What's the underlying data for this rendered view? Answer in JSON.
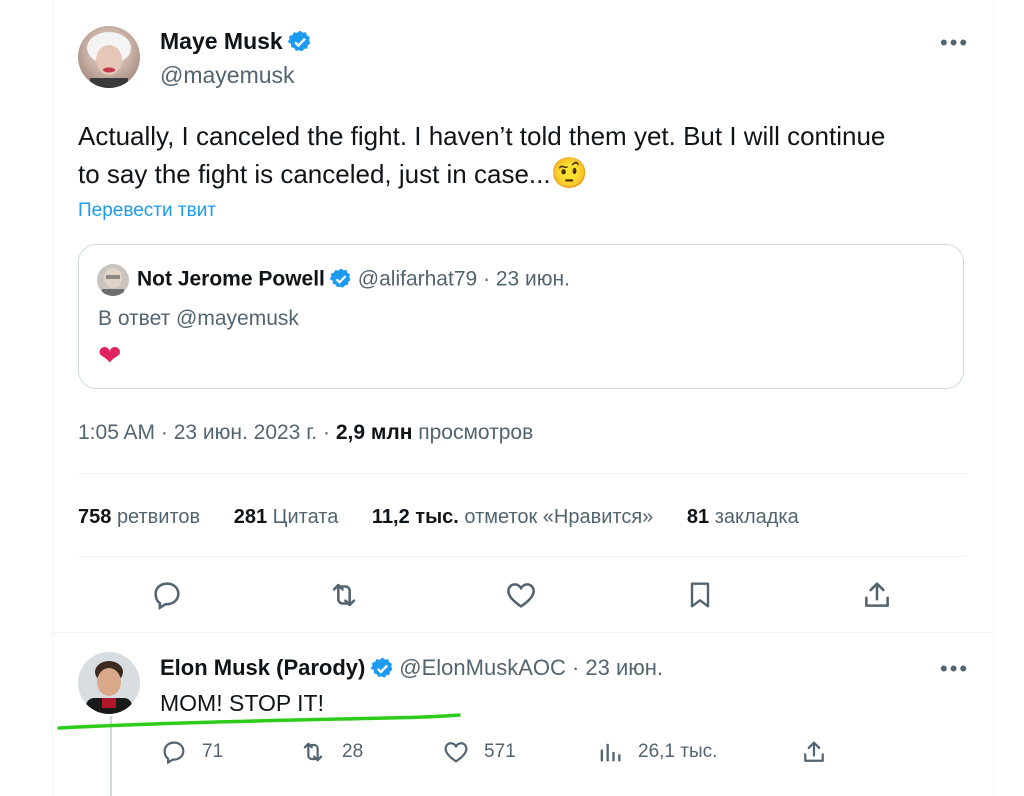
{
  "main_tweet": {
    "author_name": "Maye Musk",
    "handle": "@mayemusk",
    "text_line1": "Actually, I canceled the fight. I haven’t told them yet. But I will continue",
    "text_line2": "to say the fight is canceled, just in case...",
    "emoji": "🤨",
    "translate_label": "Перевести твит",
    "more_label": "•••",
    "quoted": {
      "author_name": "Not Jerome Powell",
      "handle_date": "@alifarhat79 · 23 июн.",
      "reply_to": "В ответ @mayemusk",
      "heart": "❤"
    },
    "meta": {
      "time_date": "1:05 AM · 23 июн. 2023 г. ·",
      "views_count": "2,9 млн",
      "views_label": "просмотров"
    },
    "stats": [
      {
        "count": "758",
        "label": "ретвитов"
      },
      {
        "count": "281",
        "label": "Цитата"
      },
      {
        "count": "11,2 тыс.",
        "label": "отметок «Нравится»"
      },
      {
        "count": "81",
        "label": "закладка"
      }
    ]
  },
  "reply_tweet": {
    "author_name": "Elon Musk (Parody)",
    "handle_date": "@ElonMuskAOC · 23 июн.",
    "text": "MOM! STOP IT!",
    "more_label": "•••",
    "actions": {
      "replies": "71",
      "retweets": "28",
      "likes": "571",
      "views": "26,1 тыс."
    }
  },
  "colors": {
    "accent": "#1d9bf0",
    "secondary_text": "#536471",
    "heart": "#f91880",
    "highlight_underline": "#2ecc1a"
  }
}
